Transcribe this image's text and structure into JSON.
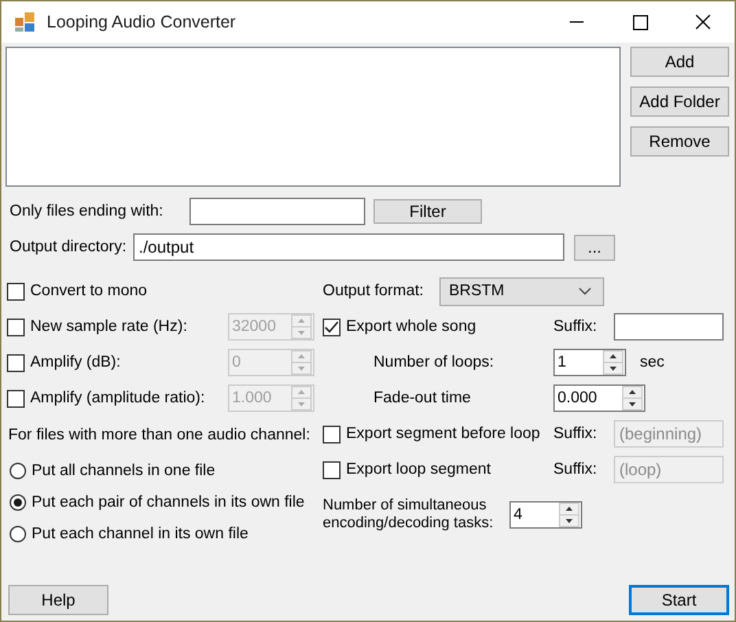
{
  "window": {
    "title": "Looping Audio Converter"
  },
  "file_list_buttons": [
    "Add",
    "Add Folder",
    "Remove"
  ],
  "filter": {
    "label": "Only files ending with:",
    "button": "Filter"
  },
  "output_directory": {
    "label": "Output directory:",
    "value": "./output",
    "button": "..."
  },
  "left_options": [
    {
      "kind": "checkbox",
      "label": "Convert to mono",
      "checked": false
    },
    {
      "kind": "spin",
      "label": "New sample rate (Hz):",
      "checked": false,
      "value": "32000",
      "disabled": true
    },
    {
      "kind": "spin",
      "label": "Amplify (dB):",
      "checked": false,
      "value": "0",
      "disabled": true
    },
    {
      "kind": "spin",
      "label": "Amplify (amplitude ratio):",
      "checked": false,
      "value": "1.000",
      "disabled": true
    }
  ],
  "channel_mode": {
    "label": "For files with more than one audio channel:",
    "options": [
      {
        "label": "Put all channels in one file",
        "selected": false
      },
      {
        "label": "Put each pair of channels in its own file",
        "selected": true
      },
      {
        "label": "Put each channel in its own file",
        "selected": false
      }
    ]
  },
  "output_format": {
    "label": "Output format:",
    "value": "BRSTM"
  },
  "export_whole": {
    "label": "Export whole song",
    "checked": true,
    "suffix_label": "Suffix:"
  },
  "loops": {
    "label": "Number of loops:",
    "value": "1",
    "unit": "sec"
  },
  "fade": {
    "label": "Fade-out time",
    "value": "0.000"
  },
  "export_segments": [
    {
      "label": "Export segment before loop",
      "checked": false,
      "suffix_label": "Suffix:",
      "suffix": "(beginning)",
      "disabled": true
    },
    {
      "label": "Export loop segment",
      "checked": false,
      "suffix_label": "Suffix:",
      "suffix": "(loop)",
      "disabled": true
    }
  ],
  "tasks": {
    "label": "Number of simultaneous encoding/decoding tasks:",
    "value": "4"
  },
  "buttons": {
    "help": "Help",
    "start": "Start"
  }
}
